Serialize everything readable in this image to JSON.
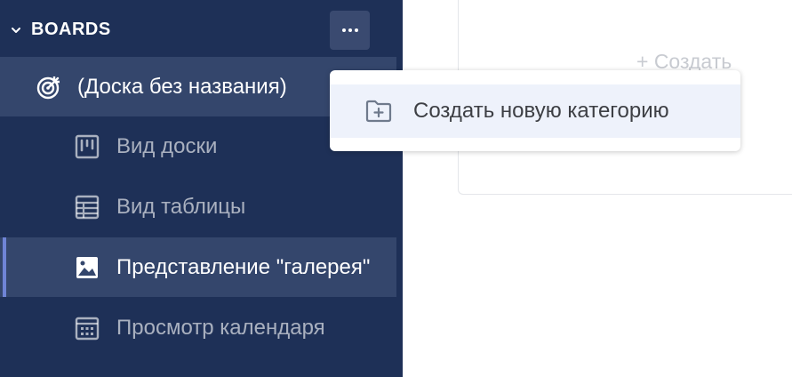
{
  "sidebar": {
    "section_title": "BOARDS",
    "board_title": "(Доска без названия)",
    "views": [
      {
        "label": "Вид доски",
        "icon": "board-view-icon"
      },
      {
        "label": "Вид таблицы",
        "icon": "table-view-icon"
      },
      {
        "label": "Представление \"галерея\"",
        "icon": "gallery-view-icon"
      },
      {
        "label": "Просмотр календаря",
        "icon": "calendar-view-icon"
      }
    ],
    "active_view_index": 2
  },
  "main": {
    "create_label": "+ Создать"
  },
  "menu": {
    "items": [
      {
        "label": "Создать новую категорию",
        "icon": "folder-plus-icon"
      }
    ]
  },
  "colors": {
    "sidebar_bg": "#1e3057",
    "row_highlight": "#34466c",
    "active_accent": "#6f84d6",
    "menu_hover": "#eef2fb"
  }
}
